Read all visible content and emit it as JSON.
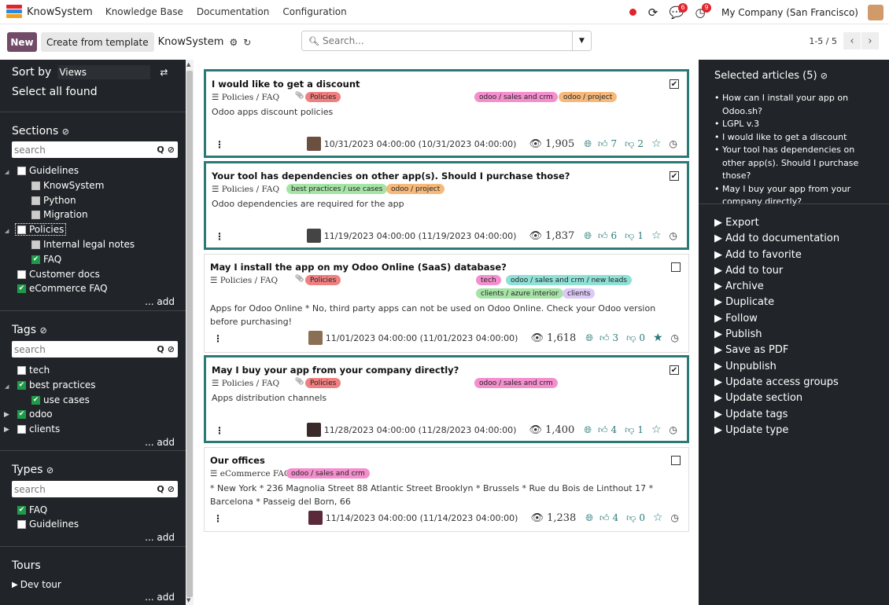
{
  "topbar": {
    "app_name": "KnowSystem",
    "nav": [
      "Knowledge Base",
      "Documentation",
      "Configuration"
    ],
    "chat_badge": "6",
    "activity_badge": "9",
    "company": "My Company (San Francisco)"
  },
  "control": {
    "new_label": "New",
    "template_label": "Create from template",
    "breadcrumb": "KnowSystem",
    "search_placeholder": "Search...",
    "pager": "1-5 / 5"
  },
  "sidebar": {
    "sort_label": "Sort by",
    "sort_value": "Views",
    "select_all": "Select all found",
    "sections": {
      "title": "Sections",
      "search_placeholder": "search",
      "items": [
        "Guidelines",
        "KnowSystem",
        "Python",
        "Migration",
        "Policies",
        "Internal legal notes",
        "FAQ",
        "Customer docs",
        "eCommerce FAQ"
      ],
      "add": "... add"
    },
    "tags": {
      "title": "Tags",
      "search_placeholder": "search",
      "items": [
        "tech",
        "best practices",
        "use cases",
        "odoo",
        "clients"
      ],
      "add": "... add"
    },
    "types": {
      "title": "Types",
      "search_placeholder": "search",
      "items": [
        "FAQ",
        "Guidelines"
      ],
      "add": "... add"
    },
    "tours": {
      "title": "Tours",
      "items": [
        "Dev tour"
      ],
      "add": "... add"
    }
  },
  "articles": [
    {
      "title": "I would like to get a discount",
      "section": "Policies / FAQ",
      "tags": [
        "Policies",
        "odoo / sales and crm",
        "odoo / project"
      ],
      "description": "Odoo apps discount policies",
      "date": "10/31/2023 04:00:00 (10/31/2023 04:00:00)",
      "views": "1,905",
      "likes": "7",
      "dislikes": "2"
    },
    {
      "title": "Your tool has dependencies on other app(s). Should I purchase those?",
      "section": "Policies / FAQ",
      "tags": [
        "best practices / use cases",
        "odoo / project"
      ],
      "description": "Odoo dependencies are required for the app",
      "date": "11/19/2023 04:00:00 (11/19/2023 04:00:00)",
      "views": "1,837",
      "likes": "6",
      "dislikes": "1"
    },
    {
      "title": "May I install the app on my Odoo Online (SaaS) database?",
      "section": "Policies / FAQ",
      "tags": [
        "Policies",
        "tech",
        "odoo / sales and crm / new leads",
        "clients / azure interior",
        "clients"
      ],
      "description": "Apps for Odoo Online * No, third party apps can not be used on Odoo Online. Check your Odoo version before purchasing!",
      "date": "11/01/2023 04:00:00 (11/01/2023 04:00:00)",
      "views": "1,618",
      "likes": "3",
      "dislikes": "0"
    },
    {
      "title": "May I buy your app from your company directly?",
      "section": "Policies / FAQ",
      "tags": [
        "Policies",
        "odoo / sales and crm"
      ],
      "description": "Apps distribution channels",
      "date": "11/28/2023 04:00:00 (11/28/2023 04:00:00)",
      "views": "1,400",
      "likes": "4",
      "dislikes": "1"
    },
    {
      "title": "Our offices",
      "section": "eCommerce FAQ",
      "tags": [
        "odoo / sales and crm"
      ],
      "description": "* New York * 236 Magnolia Street 88 Atlantic Street Brooklyn * Brussels * Rue du Bois de Linthout 17 * Barcelona * Passeig del Born, 66",
      "date": "11/14/2023 04:00:00 (11/14/2023 04:00:00)",
      "views": "1,238",
      "likes": "4",
      "dislikes": "0"
    }
  ],
  "right_panel": {
    "title": "Selected articles (5)",
    "selected": [
      "How can I install your app on Odoo.sh?",
      "LGPL v.3",
      "I would like to get a discount",
      "Your tool has dependencies on other app(s). Should I purchase those?",
      "May I buy your app from your company directly?"
    ],
    "actions": [
      "Export",
      "Add to documentation",
      "Add to favorite",
      "Add to tour",
      "Archive",
      "Duplicate",
      "Follow",
      "Publish",
      "Save as PDF",
      "Unpublish",
      "Update access groups",
      "Update section",
      "Update tags",
      "Update type"
    ]
  },
  "colors": {
    "primary": "#714b67",
    "teal": "#2b7a78",
    "sidebar_bg": "#212529",
    "checkbox_on": "#1f9a4a",
    "badge_red": "#e0242e"
  }
}
